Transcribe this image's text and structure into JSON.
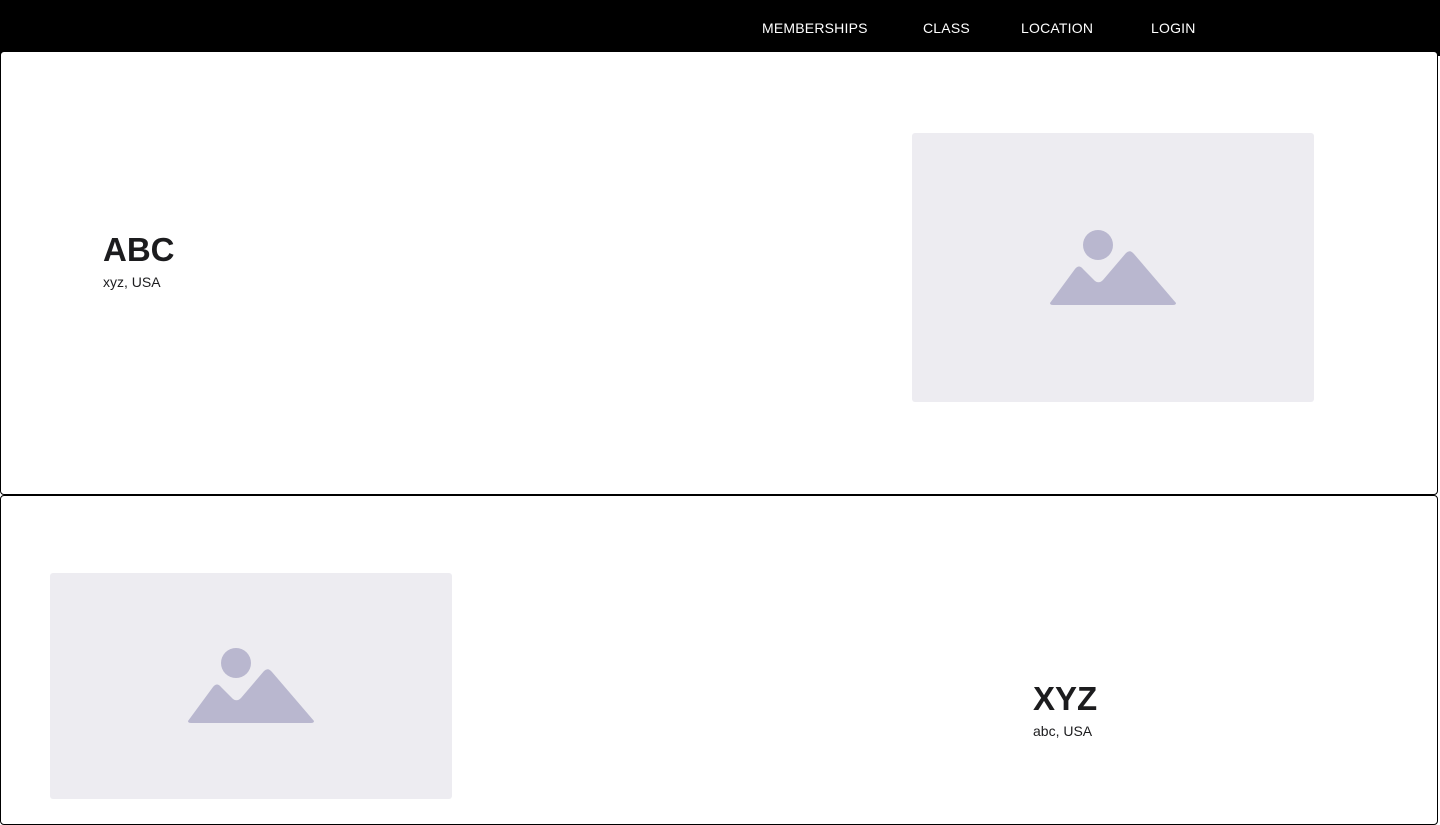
{
  "nav": {
    "items": [
      {
        "label": "MEMBERSHIPS"
      },
      {
        "label": "CLASS"
      },
      {
        "label": "LOCATION"
      },
      {
        "label": "LOGIN"
      }
    ]
  },
  "locations": [
    {
      "name": "ABC",
      "address": "xyz, USA",
      "image_icon": "image-placeholder-icon"
    },
    {
      "name": "XYZ",
      "address": "abc, USA",
      "image_icon": "image-placeholder-icon"
    }
  ],
  "colors": {
    "nav_background": "#000000",
    "nav_text": "#ffffff",
    "placeholder_background": "#edecf1",
    "placeholder_icon": "#b9b7cf",
    "text": "#1c1c1e"
  }
}
